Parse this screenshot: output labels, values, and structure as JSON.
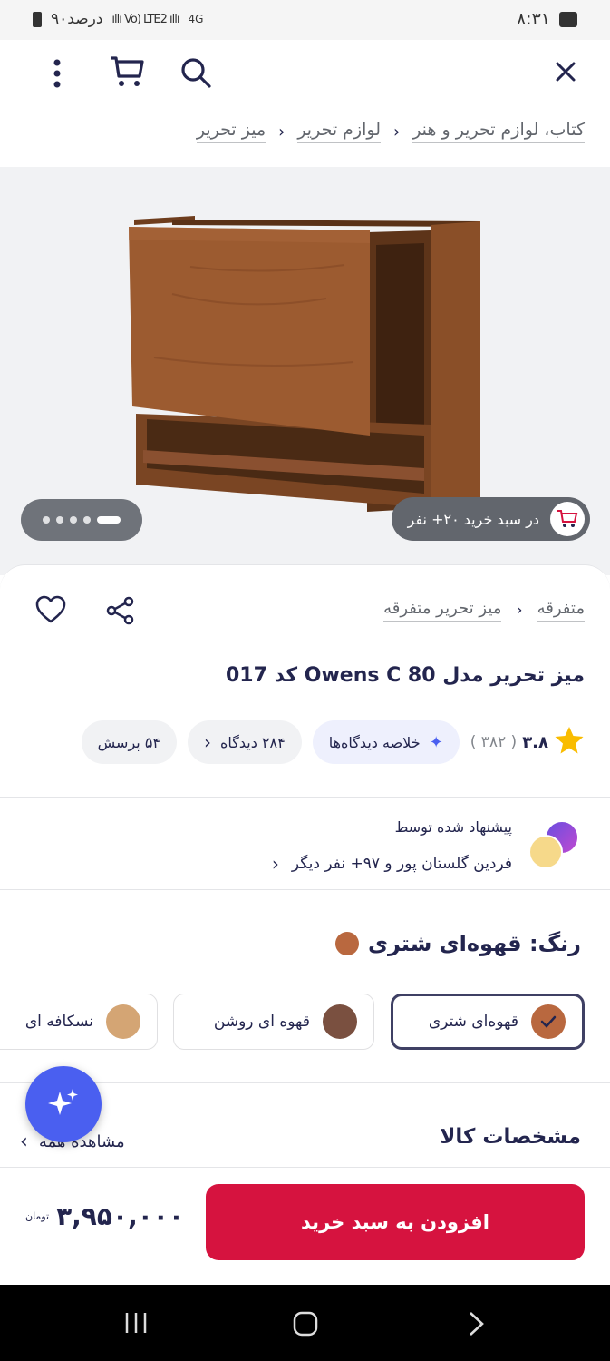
{
  "status_bar": {
    "time": "۸:۳۱",
    "battery": "۹۰درصد",
    "network": "4G"
  },
  "breadcrumb": [
    "کتاب، لوازم تحریر و هنر",
    "لوازم تحریر",
    "میز تحریر"
  ],
  "hero": {
    "in_cart_text": "در سبد خرید ۲۰+ نفر"
  },
  "category": [
    "متفرقه",
    "میز تحریر متفرقه"
  ],
  "product": {
    "title": "میز تحریر مدل Owens C 80 کد 017"
  },
  "rating": {
    "value": "۳.۸",
    "count": "( ۳۸۲ )",
    "summary_label": "خلاصه دیدگاه‌ها",
    "reviews_label": "۲۸۴ دیدگاه",
    "questions_label": "۵۴ پرسش"
  },
  "suggested": {
    "line1": "پیشنهاد شده توسط",
    "line2": "فردین گلستان پور و ۹۷+ نفر دیگر"
  },
  "color": {
    "heading": "رنگ: قهوه‌ای شتری",
    "selected_hex": "#b9683f",
    "options": [
      {
        "label": "قهوه‌ای شتری",
        "hex": "#b9683f",
        "selected": true
      },
      {
        "label": "قهوه ای روشن",
        "hex": "#7a5040",
        "selected": false
      },
      {
        "label": "نسکافه ای",
        "hex": "#d4a574",
        "selected": false
      }
    ]
  },
  "specs": {
    "heading": "مشخصات کالا",
    "see_all": "مشاهده همه"
  },
  "buy": {
    "button_label": "افزودن به سبد خرید",
    "price": "۳,۹۵۰,۰۰۰",
    "currency": "تومان",
    "accent": "#d6133f"
  },
  "icons": [
    "close-icon",
    "search-icon",
    "cart-icon",
    "more-icon",
    "heart-icon",
    "share-icon",
    "star-icon",
    "sparkle-icon"
  ]
}
